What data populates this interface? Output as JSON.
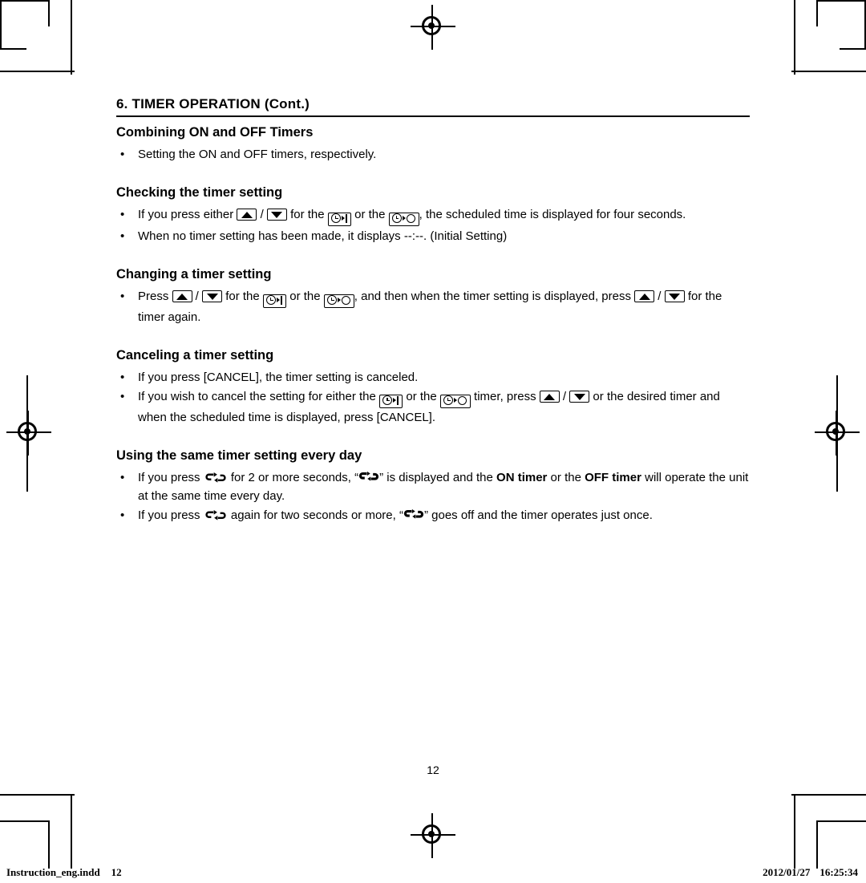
{
  "document": {
    "chapter_title": "6. TIMER OPERATION (Cont.)",
    "page_number": "12",
    "footer": {
      "file_name": "Instruction_eng.indd",
      "file_page": "12",
      "date": "2012/01/27",
      "time": "16:25:34"
    },
    "sections": [
      {
        "heading": "Combining ON and OFF Timers",
        "bullets": [
          {
            "parts": [
              {
                "t": "text",
                "v": "Setting the ON and OFF timers, respectively."
              }
            ]
          }
        ]
      },
      {
        "heading": "Checking the timer setting",
        "bullets": [
          {
            "parts": [
              {
                "t": "text",
                "v": "If you press either "
              },
              {
                "t": "icon",
                "v": "arrow-up-key"
              },
              {
                "t": "text",
                "v": " / "
              },
              {
                "t": "icon",
                "v": "arrow-down-key"
              },
              {
                "t": "text",
                "v": " for the "
              },
              {
                "t": "icon",
                "v": "timer-on-key"
              },
              {
                "t": "text",
                "v": " or the "
              },
              {
                "t": "icon",
                "v": "timer-off-key"
              },
              {
                "t": "text",
                "v": ", the scheduled time is displayed for four seconds."
              }
            ]
          },
          {
            "parts": [
              {
                "t": "text",
                "v": "When no timer setting has been made, it displays --:--. (Initial Setting)"
              }
            ]
          }
        ]
      },
      {
        "heading": "Changing a timer setting",
        "bullets": [
          {
            "parts": [
              {
                "t": "text",
                "v": "Press "
              },
              {
                "t": "icon",
                "v": "arrow-up-key"
              },
              {
                "t": "text",
                "v": " / "
              },
              {
                "t": "icon",
                "v": "arrow-down-key"
              },
              {
                "t": "text",
                "v": " for the "
              },
              {
                "t": "icon",
                "v": "timer-on-key"
              },
              {
                "t": "text",
                "v": " or the "
              },
              {
                "t": "icon",
                "v": "timer-off-key"
              },
              {
                "t": "text",
                "v": ", and then when the timer setting is displayed, press "
              },
              {
                "t": "icon",
                "v": "arrow-up-key"
              },
              {
                "t": "text",
                "v": " / "
              },
              {
                "t": "icon",
                "v": "arrow-down-key"
              },
              {
                "t": "text",
                "v": " for the timer again."
              }
            ]
          }
        ]
      },
      {
        "heading": "Canceling a timer setting",
        "bullets": [
          {
            "parts": [
              {
                "t": "text",
                "v": "If you press [CANCEL], the timer setting is canceled."
              }
            ]
          },
          {
            "parts": [
              {
                "t": "text",
                "v": "If you wish to cancel the setting for either the "
              },
              {
                "t": "icon",
                "v": "timer-on-key"
              },
              {
                "t": "text",
                "v": " or the "
              },
              {
                "t": "icon",
                "v": "timer-off-key"
              },
              {
                "t": "text",
                "v": " timer, press "
              },
              {
                "t": "icon",
                "v": "arrow-up-key"
              },
              {
                "t": "text",
                "v": " / "
              },
              {
                "t": "icon",
                "v": "arrow-down-key"
              },
              {
                "t": "text",
                "v": " or the desired timer and when the scheduled time is displayed, press [CANCEL]."
              }
            ]
          }
        ]
      },
      {
        "heading": "Using the same timer setting every day",
        "bullets": [
          {
            "parts": [
              {
                "t": "text",
                "v": "If you press "
              },
              {
                "t": "icon",
                "v": "repeat-key"
              },
              {
                "t": "text",
                "v": " for 2 or more seconds, “"
              },
              {
                "t": "icon",
                "v": "repeat-indicator"
              },
              {
                "t": "text",
                "v": "” is displayed and the "
              },
              {
                "t": "bold",
                "v": "ON timer"
              },
              {
                "t": "text",
                "v": " or the "
              },
              {
                "t": "bold",
                "v": "OFF timer"
              },
              {
                "t": "text",
                "v": " will operate the unit at the same time every day."
              }
            ]
          },
          {
            "parts": [
              {
                "t": "text",
                "v": "If you press "
              },
              {
                "t": "icon",
                "v": "repeat-key"
              },
              {
                "t": "text",
                "v": " again for two seconds or more, “"
              },
              {
                "t": "icon",
                "v": "repeat-indicator"
              },
              {
                "t": "text",
                "v": "” goes off and the timer operates just once."
              }
            ]
          }
        ]
      }
    ]
  }
}
